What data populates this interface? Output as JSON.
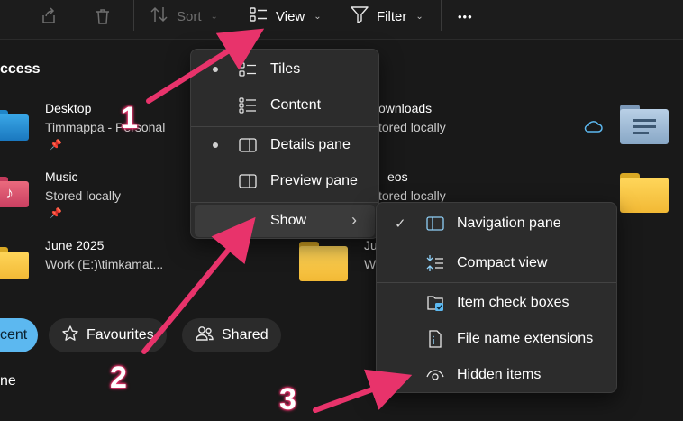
{
  "toolbar": {
    "sort_label": "Sort",
    "view_label": "View",
    "filter_label": "Filter",
    "more_label": "•••",
    "icons": [
      "share-icon",
      "delete-icon",
      "sort-icon",
      "view-icon",
      "filter-icon",
      "more-icon"
    ]
  },
  "quick_access": {
    "title": "ccess",
    "items": [
      {
        "name": "Desktop",
        "sub": "Timmappa - Personal",
        "pinned": true
      },
      {
        "name": "Music",
        "sub": "Stored locally",
        "pinned": true
      },
      {
        "name": "June 2025",
        "sub": "Work (E:)\\timkamat..."
      },
      {
        "name": "ownloads",
        "sub": "tored locally"
      },
      {
        "name": "eos",
        "sub": "tored locally"
      },
      {
        "name": "Ju",
        "sub": "W"
      }
    ]
  },
  "chips": {
    "recent": "cent",
    "favourites": "Favourites",
    "shared": "Shared"
  },
  "list_heading": "ne",
  "view_menu": {
    "items": [
      {
        "label": "Tiles",
        "selected": true
      },
      {
        "label": "Content",
        "selected": false
      },
      {
        "label": "Details pane",
        "selected": true
      },
      {
        "label": "Preview pane",
        "selected": false
      },
      {
        "label": "Show",
        "submenu_arrow": "›"
      }
    ]
  },
  "show_menu": {
    "items": [
      {
        "label": "Navigation pane",
        "checked": true
      },
      {
        "label": "Compact view",
        "checked": false
      },
      {
        "label": "Item check boxes",
        "checked": false
      },
      {
        "label": "File name extensions",
        "checked": false
      },
      {
        "label": "Hidden items",
        "checked": false
      }
    ],
    "check_glyph": "✓"
  },
  "annotations": [
    "1",
    "2",
    "3"
  ],
  "colors": {
    "background": "#191919",
    "menu": "#2c2c2c",
    "accent": "#5cb8f0",
    "annotation": "#e8336b",
    "folder": "#f4c544"
  }
}
